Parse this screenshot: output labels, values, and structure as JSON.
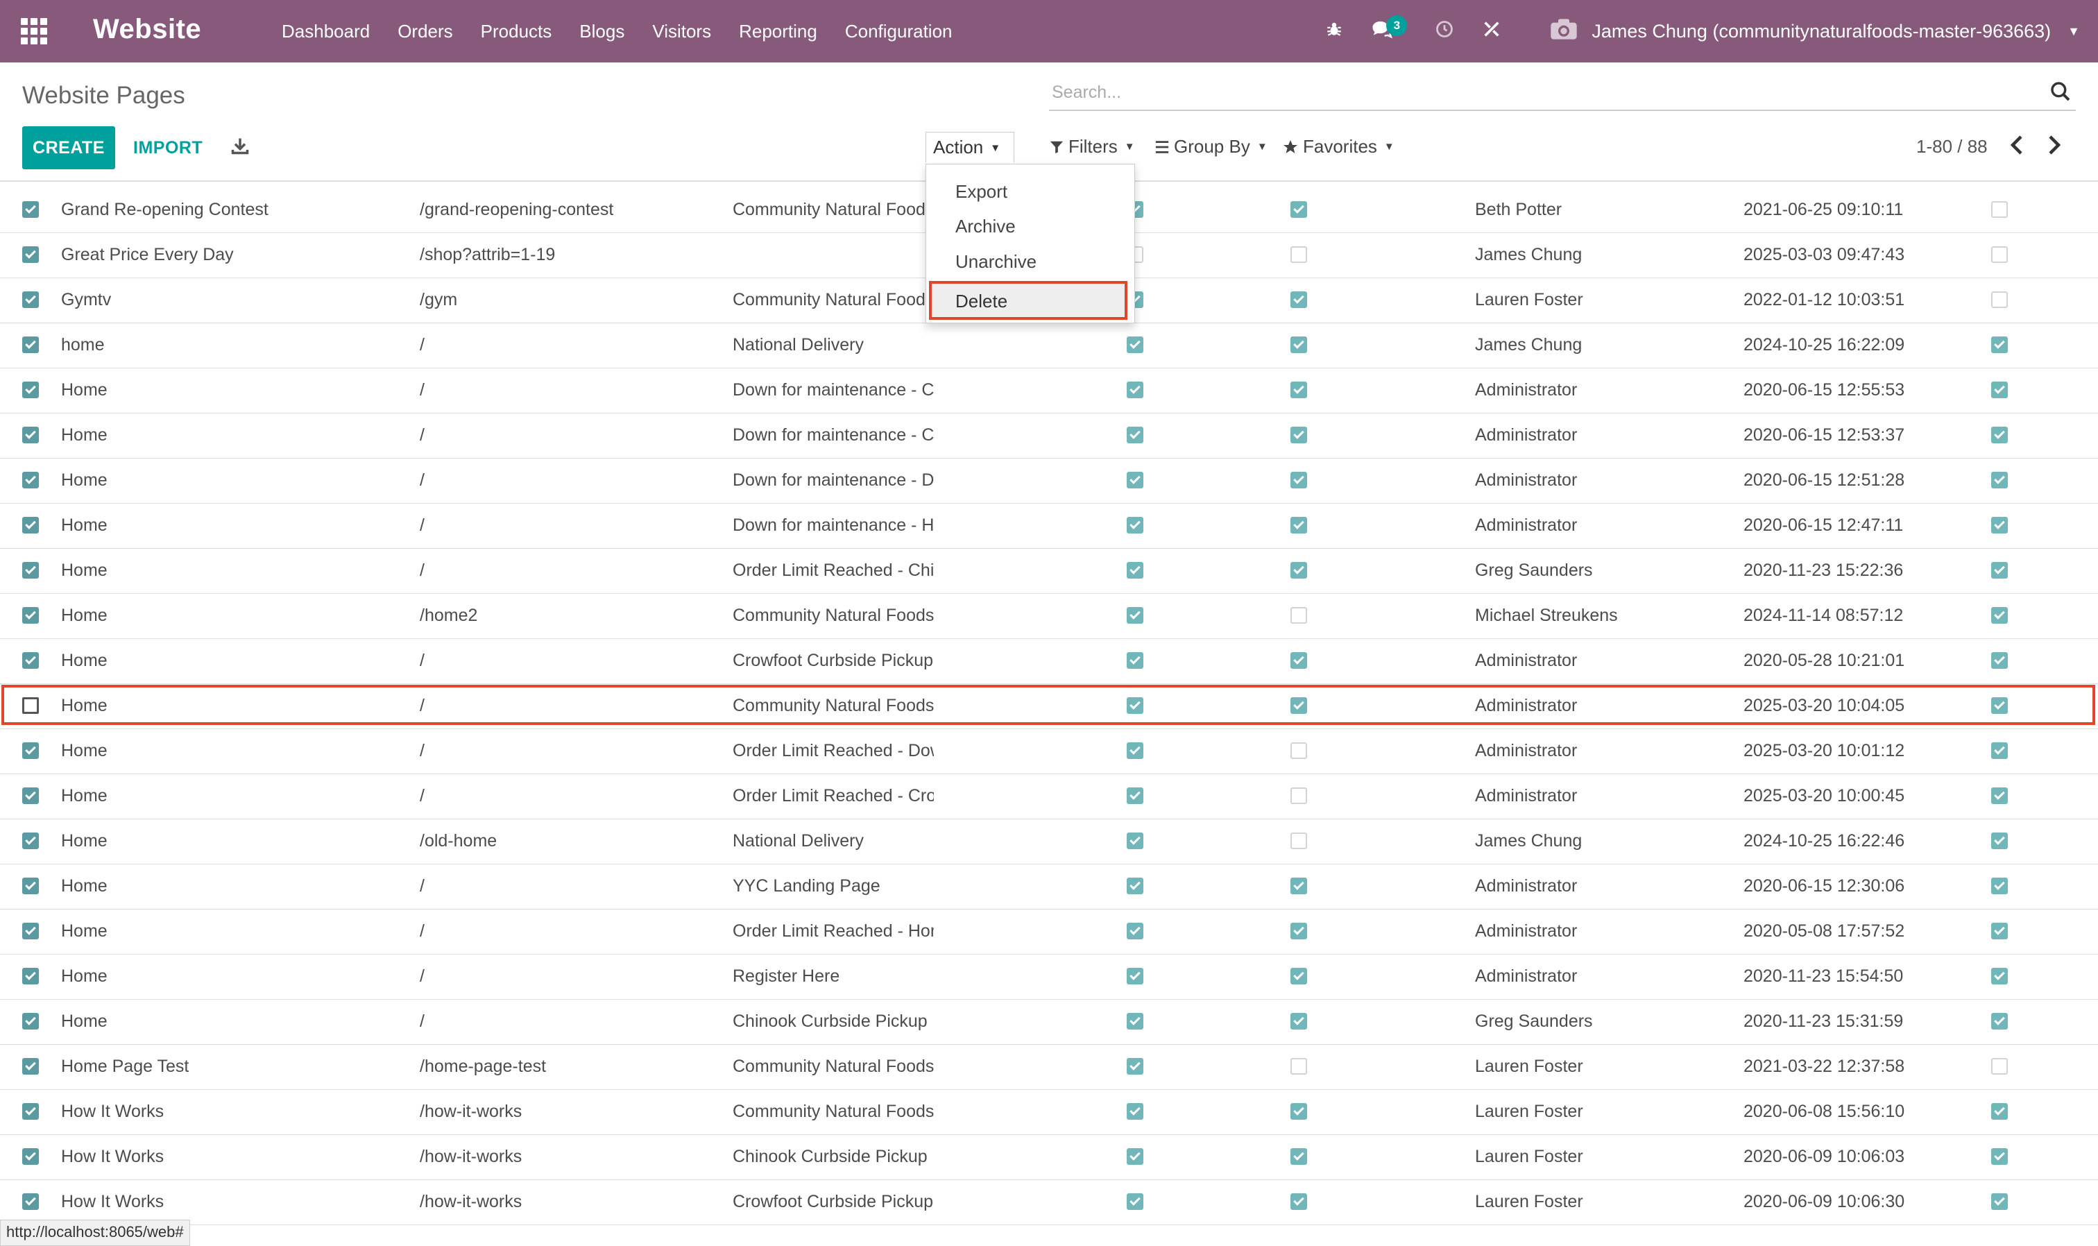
{
  "navbar": {
    "app_name": "Website",
    "menu": [
      "Dashboard",
      "Orders",
      "Products",
      "Blogs",
      "Visitors",
      "Reporting",
      "Configuration"
    ],
    "chat_count": "3",
    "user_label": "James Chung (communitynaturalfoods-master-963663)",
    "bg_color": "#875a7b"
  },
  "control_panel": {
    "breadcrumb": "Website Pages",
    "search_placeholder": "Search...",
    "create_label": "CREATE",
    "import_label": "IMPORT",
    "action_label": "Action",
    "filters_label": "Filters",
    "groupby_label": "Group By",
    "favorites_label": "Favorites",
    "pager": "1-80 / 88",
    "accent_color": "#00a09d"
  },
  "action_menu": {
    "items": [
      "Export",
      "Archive",
      "Unarchive",
      "Delete"
    ],
    "highlighted": "Delete"
  },
  "rows": [
    {
      "name": "Grand Re-opening Contest",
      "url": "/grand-reopening-contest",
      "website": "Community Natural Foods",
      "selected": true,
      "indexed": true,
      "published": true,
      "author": "Beth Potter",
      "date": "2021-06-25 09:10:11",
      "active": false
    },
    {
      "name": "Great Price Every Day",
      "url": "/shop?attrib=1-19",
      "website": "",
      "selected": true,
      "indexed": false,
      "published": false,
      "author": "James Chung",
      "date": "2025-03-03 09:47:43",
      "active": false
    },
    {
      "name": "Gymtv",
      "url": "/gym",
      "website": "Community Natural Foods",
      "selected": true,
      "indexed": true,
      "published": true,
      "author": "Lauren Foster",
      "date": "2022-01-12 10:03:51",
      "active": false
    },
    {
      "name": "home",
      "url": "/",
      "website": "National Delivery",
      "selected": true,
      "indexed": true,
      "published": true,
      "author": "James Chung",
      "date": "2024-10-25 16:22:09",
      "active": true
    },
    {
      "name": "Home",
      "url": "/",
      "website": "Down for maintenance - Chinook",
      "selected": true,
      "indexed": true,
      "published": true,
      "author": "Administrator",
      "date": "2020-06-15 12:55:53",
      "active": true
    },
    {
      "name": "Home",
      "url": "/",
      "website": "Down for maintenance - Crowfoot",
      "selected": true,
      "indexed": true,
      "published": true,
      "author": "Administrator",
      "date": "2020-06-15 12:53:37",
      "active": true
    },
    {
      "name": "Home",
      "url": "/",
      "website": "Down for maintenance - Downtown",
      "selected": true,
      "indexed": true,
      "published": true,
      "author": "Administrator",
      "date": "2020-06-15 12:51:28",
      "active": true
    },
    {
      "name": "Home",
      "url": "/",
      "website": "Down for maintenance - Home Delivery",
      "selected": true,
      "indexed": true,
      "published": true,
      "author": "Administrator",
      "date": "2020-06-15 12:47:11",
      "active": true
    },
    {
      "name": "Home",
      "url": "/",
      "website": "Order Limit Reached - Chinook",
      "selected": true,
      "indexed": true,
      "published": true,
      "author": "Greg Saunders",
      "date": "2020-11-23 15:22:36",
      "active": true
    },
    {
      "name": "Home",
      "url": "/home2",
      "website": "Community Natural Foods",
      "selected": true,
      "indexed": true,
      "published": false,
      "author": "Michael Streukens",
      "date": "2024-11-14 08:57:12",
      "active": true
    },
    {
      "name": "Home",
      "url": "/",
      "website": "Crowfoot Curbside Pickup",
      "selected": true,
      "indexed": true,
      "published": true,
      "author": "Administrator",
      "date": "2020-05-28 10:21:01",
      "active": true
    },
    {
      "name": "Home",
      "url": "/",
      "website": "Community Natural Foods",
      "selected": false,
      "indexed": true,
      "published": true,
      "author": "Administrator",
      "date": "2025-03-20 10:04:05",
      "active": true
    },
    {
      "name": "Home",
      "url": "/",
      "website": "Order Limit Reached - Downtown",
      "selected": true,
      "indexed": true,
      "published": false,
      "author": "Administrator",
      "date": "2025-03-20 10:01:12",
      "active": true
    },
    {
      "name": "Home",
      "url": "/",
      "website": "Order Limit Reached - Crowfoot",
      "selected": true,
      "indexed": true,
      "published": false,
      "author": "Administrator",
      "date": "2025-03-20 10:00:45",
      "active": true
    },
    {
      "name": "Home",
      "url": "/old-home",
      "website": "National Delivery",
      "selected": true,
      "indexed": true,
      "published": false,
      "author": "James Chung",
      "date": "2024-10-25 16:22:46",
      "active": true
    },
    {
      "name": "Home",
      "url": "/",
      "website": "YYC Landing Page",
      "selected": true,
      "indexed": true,
      "published": true,
      "author": "Administrator",
      "date": "2020-06-15 12:30:06",
      "active": true
    },
    {
      "name": "Home",
      "url": "/",
      "website": "Order Limit Reached - Home Delivery",
      "selected": true,
      "indexed": true,
      "published": true,
      "author": "Administrator",
      "date": "2020-05-08 17:57:52",
      "active": true
    },
    {
      "name": "Home",
      "url": "/",
      "website": "Register Here",
      "selected": true,
      "indexed": true,
      "published": true,
      "author": "Administrator",
      "date": "2020-11-23 15:54:50",
      "active": true
    },
    {
      "name": "Home",
      "url": "/",
      "website": "Chinook Curbside Pickup",
      "selected": true,
      "indexed": true,
      "published": true,
      "author": "Greg Saunders",
      "date": "2020-11-23 15:31:59",
      "active": true
    },
    {
      "name": "Home Page Test",
      "url": "/home-page-test",
      "website": "Community Natural Foods",
      "selected": true,
      "indexed": true,
      "published": false,
      "author": "Lauren Foster",
      "date": "2021-03-22 12:37:58",
      "active": false
    },
    {
      "name": "How It Works",
      "url": "/how-it-works",
      "website": "Community Natural Foods",
      "selected": true,
      "indexed": true,
      "published": true,
      "author": "Lauren Foster",
      "date": "2020-06-08 15:56:10",
      "active": true
    },
    {
      "name": "How It Works",
      "url": "/how-it-works",
      "website": "Chinook Curbside Pickup",
      "selected": true,
      "indexed": true,
      "published": true,
      "author": "Lauren Foster",
      "date": "2020-06-09 10:06:03",
      "active": true
    },
    {
      "name": "How It Works",
      "url": "/how-it-works",
      "website": "Crowfoot Curbside Pickup",
      "selected": true,
      "indexed": true,
      "published": true,
      "author": "Lauren Foster",
      "date": "2020-06-09 10:06:30",
      "active": true
    }
  ],
  "status_bar": {
    "url": "http://localhost:8065/web#"
  }
}
